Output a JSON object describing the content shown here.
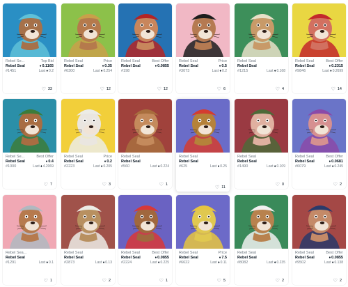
{
  "cards": [
    {
      "bg": "#2a8fc4",
      "fur": "#a6714a",
      "hat": "#5fc1d8",
      "collection": "Rebel Se...",
      "name": "Rebel Seal",
      "id": "#1451",
      "label": "Top Bid",
      "value": "0.1165",
      "last": "0.2",
      "likes": "33"
    },
    {
      "bg": "#8cc14a",
      "fur": "#b57a4c",
      "hat": "#c9a04a",
      "collection": "Rebel Seal",
      "name": "Rebel Seal",
      "id": "#6300",
      "label": "Price",
      "value": "0.35",
      "last": "0.254",
      "likes": "12"
    },
    {
      "bg": "#2572b3",
      "fur": "#c8865c",
      "hat": "#b42424",
      "collection": "Rebel Seal",
      "name": "Rebel Seal",
      "id": "#198",
      "label": "Best Offer",
      "value": "0.0855",
      "last": "",
      "likes": "12"
    },
    {
      "bg": "#f1b8c5",
      "fur": "#b57a52",
      "hat": "#1d1d1d",
      "collection": "Rebel Seal",
      "name": "Rebel Seal",
      "id": "#3073",
      "label": "Price",
      "value": "0.5",
      "last": "0.2",
      "likes": "6"
    },
    {
      "bg": "#3d8f5a",
      "fur": "#c89a68",
      "hat": "#e8e0c8",
      "collection": "Rebel Seal",
      "name": "Rebel Seal",
      "id": "#1215",
      "label": "",
      "value": "",
      "last": "0.168",
      "likes": "4"
    },
    {
      "bg": "#e9d742",
      "fur": "#d27060",
      "hat": "#c3282c",
      "collection": "Rebel Seal",
      "name": "Rebel Seal",
      "id": "#9846",
      "label": "Best Offer",
      "value": "0.2315",
      "last": "0.2699",
      "likes": "14"
    },
    {
      "bg": "#2b8fa8",
      "fur": "#a86d42",
      "hat": "#3c7c3a",
      "collection": "Rebel Se...",
      "name": "Rebel Seal",
      "id": "#1000",
      "label": "Best Offer",
      "value": "0.4",
      "last": "4.2069",
      "likes": "7"
    },
    {
      "bg": "#f2cf3a",
      "fur": "#eae6e0",
      "hat": "#ecece6",
      "collection": "Rebel Seal",
      "name": "Rebel Seal",
      "id": "#2223",
      "label": "Price",
      "value": "0.2",
      "last": "0.205",
      "likes": "3"
    },
    {
      "bg": "#a0423c",
      "fur": "#c48a5c",
      "hat": "#a86e3e",
      "collection": "Rebel Seal",
      "name": "Rebel Seal",
      "id": "#560",
      "label": "",
      "value": "",
      "last": "0.224",
      "likes": "1"
    },
    {
      "bg": "#6a6cc8",
      "fur": "#b5823a",
      "hat": "#d43c30",
      "collection": "Rebel Seal",
      "name": "Rebel Seal",
      "id": "#625",
      "label": "",
      "value": "",
      "last": "0.25",
      "likes": "11"
    },
    {
      "bg": "#9a3a42",
      "fur": "#e0b0a0",
      "hat": "#4e6a38",
      "collection": "Rebel Seal",
      "name": "Rebel Seal",
      "id": "#1490",
      "label": "",
      "value": "",
      "last": "0.109",
      "likes": "0"
    },
    {
      "bg": "#6a74c8",
      "fur": "#d69090",
      "hat": "#8a4aa8",
      "collection": "Rebel Seal",
      "name": "Rebel Seal",
      "id": "#6079",
      "label": "Best Offer",
      "value": "0.0681",
      "last": "0.245",
      "likes": "2"
    },
    {
      "bg": "#f0a8b4",
      "fur": "#b67a4e",
      "hat": "#b0b8c0",
      "collection": "Rebel Sea...",
      "name": "Rebel Seal",
      "id": "#1291",
      "label": "",
      "value": "",
      "last": "0.1",
      "likes": "1"
    },
    {
      "bg": "#a0524a",
      "fur": "#b89060",
      "hat": "#ecece6",
      "collection": "Rebel Seal",
      "name": "Rebel Seal",
      "id": "#2873",
      "label": "",
      "value": "",
      "last": "0.13",
      "likes": "2"
    },
    {
      "bg": "#6a62c2",
      "fur": "#a0683e",
      "hat": "#d83838",
      "collection": "Rebel Seal",
      "name": "Rebel Seal",
      "id": "#2224",
      "label": "Best Offer",
      "value": "0.0855",
      "last": "0.225",
      "likes": "1"
    },
    {
      "bg": "#6c6ac8",
      "fur": "#e0c850",
      "hat": "#e6c440",
      "collection": "Rebel Seal",
      "name": "Rebel Seal",
      "id": "#6622",
      "label": "Price",
      "value": "7.5",
      "last": "0.11",
      "likes": "5"
    },
    {
      "bg": "#3a8a5a",
      "fur": "#b8824e",
      "hat": "#f0f0f0",
      "collection": "Rebel Seal",
      "name": "Rebel Seal",
      "id": "#8082",
      "label": "",
      "value": "",
      "last": "0.235",
      "likes": "2"
    },
    {
      "bg": "#a44846",
      "fur": "#c48a68",
      "hat": "#2a3a6a",
      "collection": "Rebel Seal",
      "name": "Rebel Seal",
      "id": "#9502",
      "label": "Best Offer",
      "value": "0.0855",
      "last": "0.138",
      "likes": "2"
    }
  ],
  "ui": {
    "last_prefix": "Last",
    "eth_glyph": "♦",
    "heart_glyph": "♡"
  }
}
